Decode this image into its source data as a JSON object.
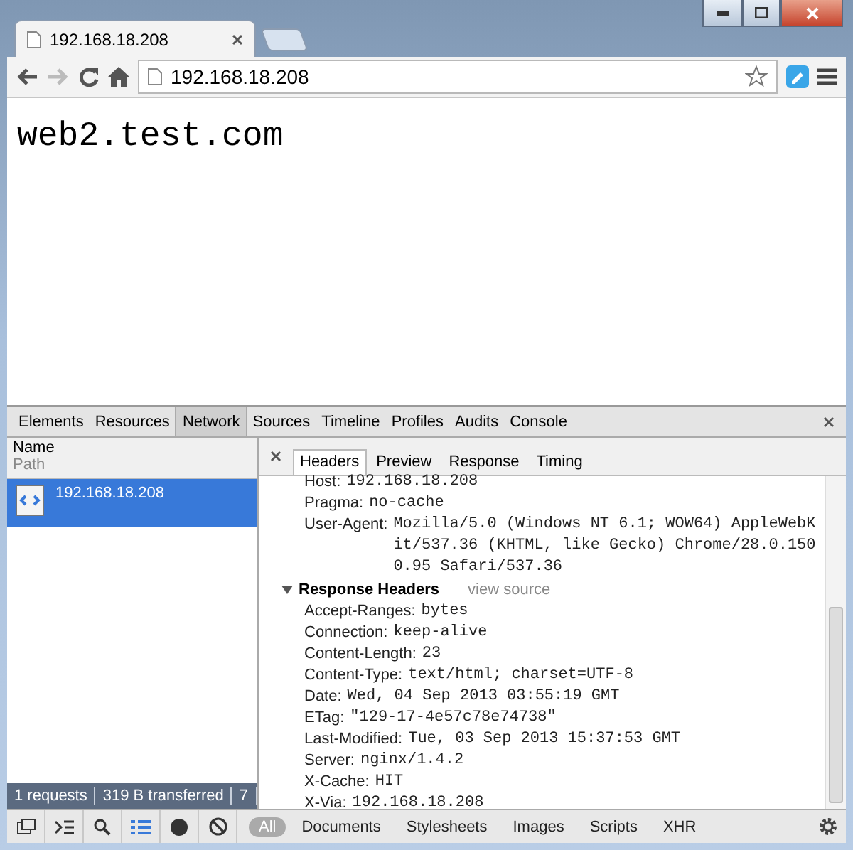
{
  "tabs": [
    {
      "title": "192.168.18.208",
      "selected": true
    }
  ],
  "address_bar": {
    "value": "192.168.18.208"
  },
  "page": {
    "heading": "web2.test.com"
  },
  "devtools": {
    "panels": [
      {
        "label": "Elements",
        "selected": false
      },
      {
        "label": "Resources",
        "selected": false
      },
      {
        "label": "Network",
        "selected": true
      },
      {
        "label": "Sources",
        "selected": false
      },
      {
        "label": "Timeline",
        "selected": false
      },
      {
        "label": "Profiles",
        "selected": false
      },
      {
        "label": "Audits",
        "selected": false
      },
      {
        "label": "Console",
        "selected": false
      }
    ],
    "requests_columns": {
      "name": "Name",
      "path": "Path"
    },
    "requests": [
      {
        "name": "192.168.18.208",
        "selected": true
      }
    ],
    "detail_tabs": [
      {
        "label": "Headers",
        "selected": true
      },
      {
        "label": "Preview",
        "selected": false
      },
      {
        "label": "Response",
        "selected": false
      },
      {
        "label": "Timing",
        "selected": false
      }
    ],
    "request_headers": [
      {
        "name": "Host:",
        "value": "192.168.18.208"
      },
      {
        "name": "Pragma:",
        "value": "no-cache"
      },
      {
        "name": "User-Agent:",
        "value": "Mozilla/5.0 (Windows NT 6.1; WOW64) AppleWebKit/537.36 (KHTML, like Gecko) Chrome/28.0.1500.95 Safari/537.36"
      }
    ],
    "response_section": {
      "title": "Response Headers",
      "expanded": true,
      "link": "view source"
    },
    "response_headers": [
      {
        "name": "Accept-Ranges:",
        "value": "bytes"
      },
      {
        "name": "Connection:",
        "value": "keep-alive"
      },
      {
        "name": "Content-Length:",
        "value": "23"
      },
      {
        "name": "Content-Type:",
        "value": "text/html; charset=UTF-8"
      },
      {
        "name": "Date:",
        "value": "Wed, 04 Sep 2013 03:55:19 GMT"
      },
      {
        "name": "ETag:",
        "value": "\"129-17-4e57c78e74738\""
      },
      {
        "name": "Last-Modified:",
        "value": "Tue, 03 Sep 2013 15:37:53 GMT"
      },
      {
        "name": "Server:",
        "value": "nginx/1.4.2"
      },
      {
        "name": "X-Cache:",
        "value": "HIT"
      },
      {
        "name": "X-Via:",
        "value": "192.168.18.208"
      }
    ],
    "status": [
      "1 requests",
      "319 B transferred",
      "7"
    ],
    "filters": [
      {
        "label": "All",
        "selected": true
      },
      {
        "label": "Documents",
        "selected": false
      },
      {
        "label": "Stylesheets",
        "selected": false
      },
      {
        "label": "Images",
        "selected": false
      },
      {
        "label": "Scripts",
        "selected": false
      },
      {
        "label": "XHR",
        "selected": false
      }
    ]
  }
}
